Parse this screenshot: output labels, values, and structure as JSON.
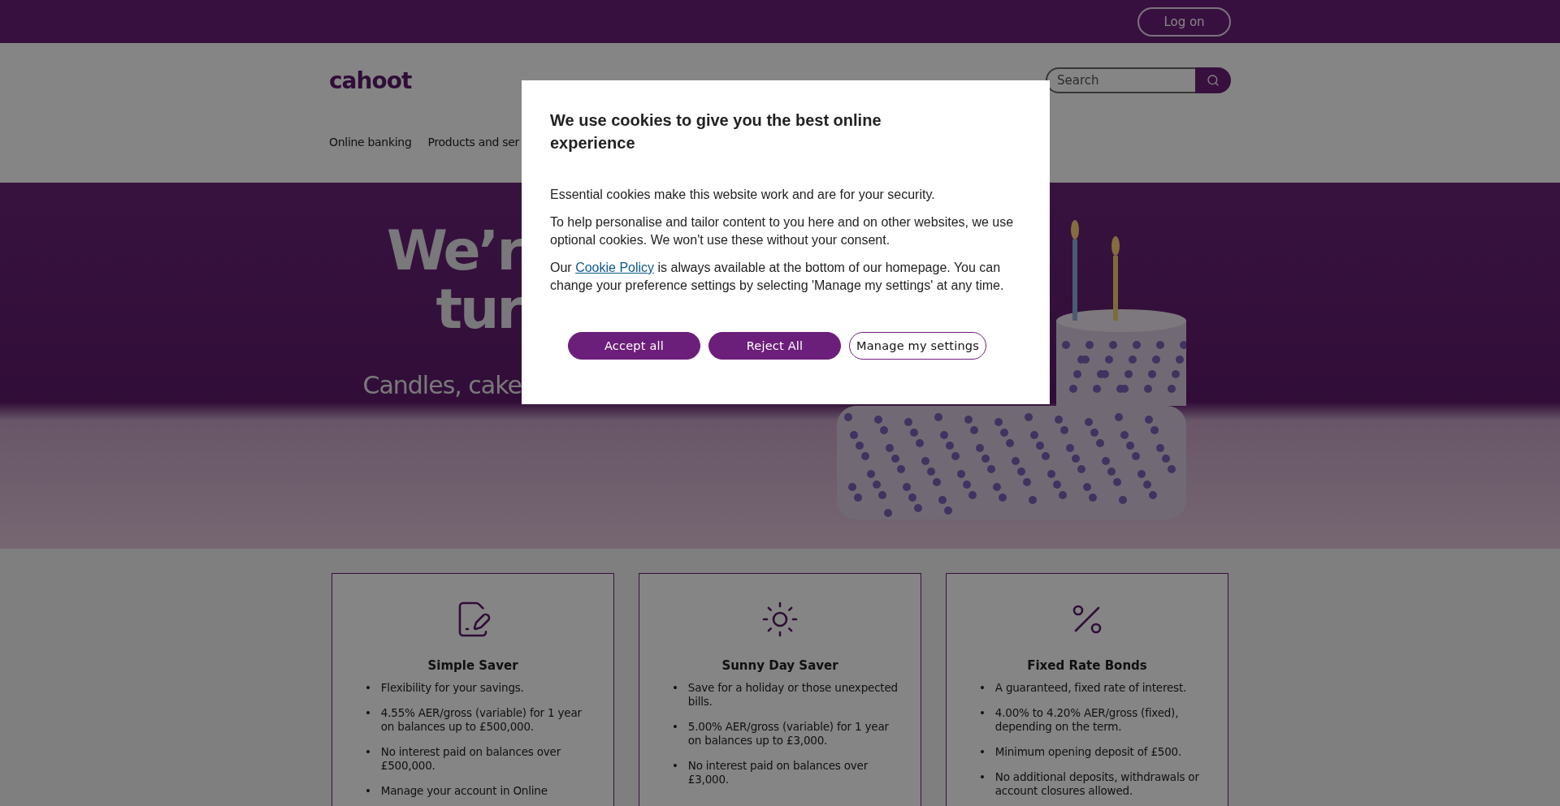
{
  "top_bar": {
    "login_button": "Log on"
  },
  "header": {
    "logo": "cahoot",
    "search": {
      "placeholder": "Search"
    }
  },
  "nav": {
    "items": [
      "Online banking",
      "Products and ser"
    ]
  },
  "hero": {
    "headline_lines": [
      "We’r",
      "tur"
    ],
    "subtitle": "Candles, cake"
  },
  "cards": [
    {
      "title": "Simple Saver",
      "marker": "•",
      "bullets": [
        "Flexibility for your savings.",
        "4.55% AER/gross (variable) for 1 year on balances up to £500,000.",
        "No interest paid on balances over £500,000.",
        "Manage your account in Online"
      ]
    },
    {
      "title": "Sunny Day Saver",
      "marker": "•",
      "bullets": [
        "Save for a holiday or those unexpected bills.",
        "5.00% AER/gross (variable) for 1 year on balances up to £3,000.",
        "No interest paid on balances over £3,000."
      ]
    },
    {
      "title": "Fixed Rate Bonds",
      "marker": "•",
      "bullets": [
        "A guaranteed, fixed rate of interest.",
        "4.00% to 4.20% AER/gross (fixed), depending on the term.",
        "Minimum opening deposit of £500.",
        "No additional deposits, withdrawals or account closures allowed."
      ]
    }
  ],
  "cookie_dialog": {
    "title": "We use cookies to give you the best online experience",
    "paragraphs": [
      {
        "before": "Essential cookies make this website work and are for your security."
      },
      {
        "before": "To help personalise and tailor content to you here and on other websites, we use optional cookies. We won't use these without your consent."
      },
      {
        "before": "Our",
        "link": "Cookie Policy",
        "after": "is always available at the bottom of our homepage. You can change your preference settings by selecting 'Manage my settings' at any time."
      }
    ],
    "buttons": [
      {
        "label": "Accept all",
        "kind": "primary"
      },
      {
        "label": "Reject All",
        "kind": "primary"
      },
      {
        "label": "Manage my settings",
        "kind": "outline"
      }
    ]
  }
}
